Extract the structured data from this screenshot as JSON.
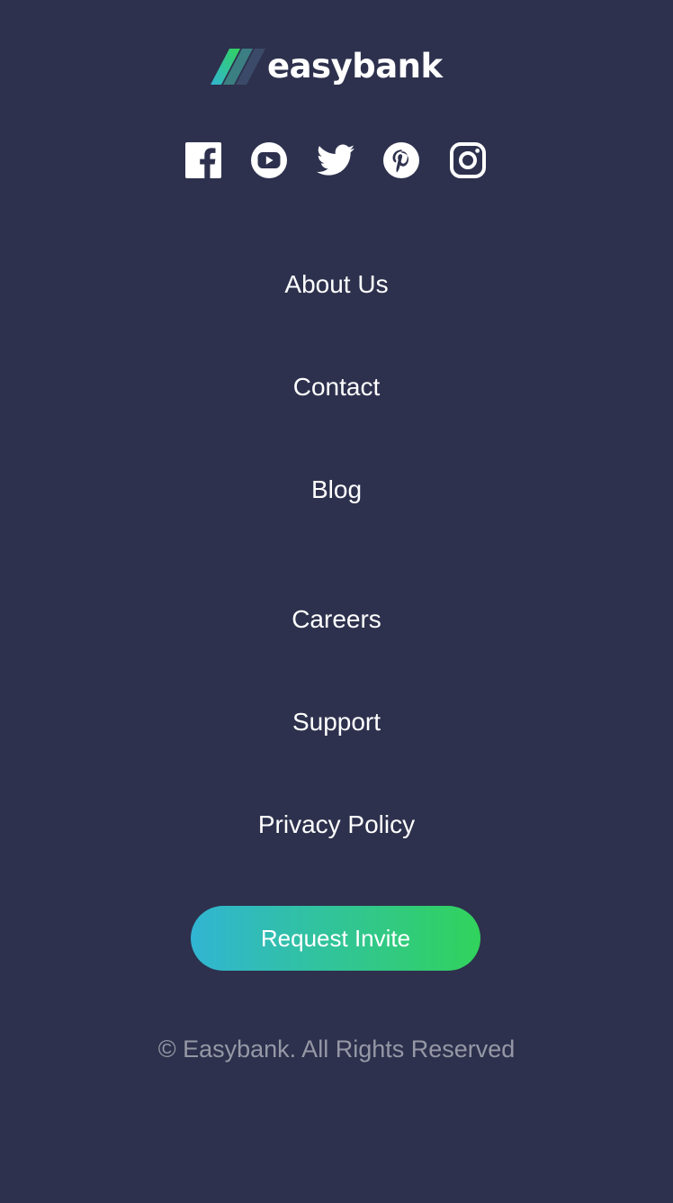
{
  "brand": {
    "name": "easybank",
    "colors": {
      "background": "#2d314d",
      "accent_start": "#31b5d3",
      "accent_end": "#31d35c",
      "muted_text": "#9698a6"
    }
  },
  "social": [
    {
      "icon": "facebook-icon"
    },
    {
      "icon": "youtube-icon"
    },
    {
      "icon": "twitter-icon"
    },
    {
      "icon": "pinterest-icon"
    },
    {
      "icon": "instagram-icon"
    }
  ],
  "nav": {
    "about": "About Us",
    "contact": "Contact",
    "blog": "Blog",
    "careers": "Careers",
    "support": "Support",
    "privacy": "Privacy Policy"
  },
  "cta": {
    "label": "Request Invite"
  },
  "copyright": "© Easybank. All Rights Reserved"
}
